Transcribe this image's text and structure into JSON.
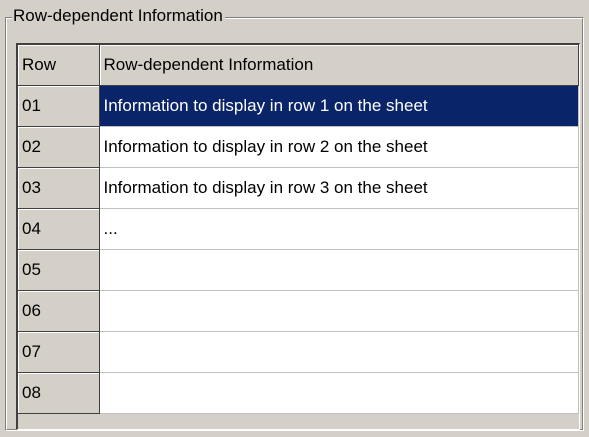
{
  "groupbox": {
    "title": "Row-dependent Information"
  },
  "grid": {
    "columns": [
      "Row",
      "Row-dependent Information"
    ],
    "rows": [
      {
        "row": "01",
        "info": "Information to display in row 1 on the sheet",
        "selected": true
      },
      {
        "row": "02",
        "info": "Information to display in row 2 on the sheet",
        "selected": false
      },
      {
        "row": "03",
        "info": "Information to display in row 3 on the sheet",
        "selected": false
      },
      {
        "row": "04",
        "info": "...",
        "selected": false
      },
      {
        "row": "05",
        "info": "",
        "selected": false
      },
      {
        "row": "06",
        "info": "",
        "selected": false
      },
      {
        "row": "07",
        "info": "",
        "selected": false
      },
      {
        "row": "08",
        "info": "",
        "selected": false
      }
    ]
  },
  "colors": {
    "face": "#d4d0c8",
    "selection": "#0a246a",
    "selection_text": "#ffffff"
  }
}
